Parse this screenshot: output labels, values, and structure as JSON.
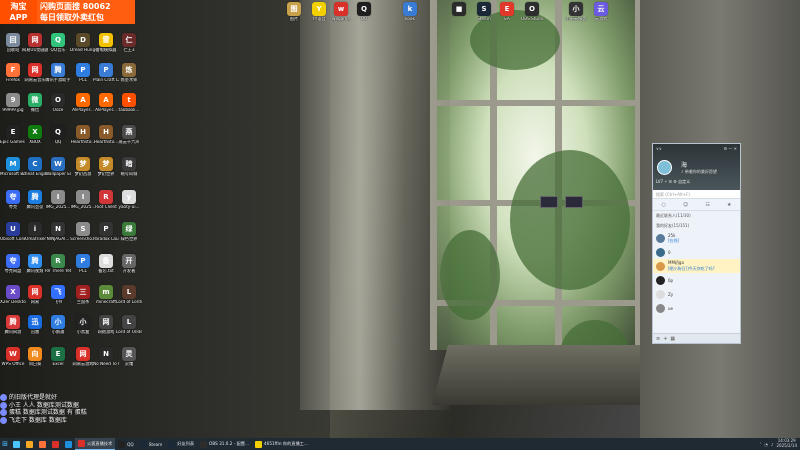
{
  "ad": {
    "left": "淘宝\nAPP",
    "line1": "闪购页面搜 80062",
    "line2": "每日领取外卖红包"
  },
  "top_icons": [
    {
      "label": "图片",
      "color": "#c9a14a",
      "icon": "folder-icon"
    },
    {
      "label": "YY语音",
      "color": "#f2d000",
      "icon": "yy-icon"
    },
    {
      "label": "wegame",
      "color": "#d9302a",
      "icon": "wegame-icon"
    },
    {
      "label": "QQ",
      "color": "#1f1f1f",
      "icon": "qq-icon"
    },
    {
      "label": "kook",
      "color": "#3a7bd5",
      "icon": "kook-icon"
    },
    {
      "label": "",
      "color": "#2b2b2b",
      "icon": "app-icon"
    },
    {
      "label": "Steam",
      "color": "#1b2838",
      "icon": "steam-icon"
    },
    {
      "label": "EA",
      "color": "#e0392b",
      "icon": "ea-icon"
    },
    {
      "label": "OBS Studio",
      "color": "#2d2d2d",
      "icon": "obs-icon"
    },
    {
      "label": "小米云服务",
      "color": "#333",
      "icon": "app-icon"
    },
    {
      "label": "云游戏",
      "color": "#6a5be0",
      "icon": "cloud-icon"
    }
  ],
  "desktop_columns": [
    [
      {
        "label": "回收站",
        "color": "#7a8a9c"
      },
      {
        "label": "Firefox",
        "color": "#ff7139"
      },
      {
        "label": "99999.jpg",
        "color": "#8c8c8c"
      },
      {
        "label": "Epic Games Launcher",
        "color": "#222"
      },
      {
        "label": "Microsoft Edge",
        "color": "#1e8fdc"
      },
      {
        "label": "夸克",
        "color": "#3b6cf6"
      },
      {
        "label": "Ubisoft Connect",
        "color": "#2a3d9c"
      },
      {
        "label": "夸克网盘",
        "color": "#3b6cf6"
      },
      {
        "label": "X2er Desktop",
        "color": "#6a4cc8"
      },
      {
        "label": "腾讯网游",
        "color": "#d83a3a"
      },
      {
        "label": "WPS Office",
        "color": "#d9302a"
      }
    ],
    [
      {
        "label": "网易UU加速器",
        "color": "#b83030"
      },
      {
        "label": "网易云音乐",
        "color": "#d9302a"
      },
      {
        "label": "微信",
        "color": "#2aae67"
      },
      {
        "label": "XBOX",
        "color": "#107c10"
      },
      {
        "label": "Cheat Engine",
        "color": "#1e6fc2"
      },
      {
        "label": "腾讯会议",
        "color": "#1b7de0"
      },
      {
        "label": "iOmatrixer",
        "color": "#2b2b2b"
      },
      {
        "label": "腾讯视频",
        "color": "#2f8df0"
      },
      {
        "label": "网易",
        "color": "#d9302a"
      },
      {
        "label": "迅雷",
        "color": "#1a6be0"
      },
      {
        "label": "向日葵",
        "color": "#f08a1c"
      }
    ],
    [
      {
        "label": "QQ音乐",
        "color": "#31c27c"
      },
      {
        "label": "腾讯手游助手",
        "color": "#3a7bd5"
      },
      {
        "label": "Ooze",
        "color": "#2a2a2a"
      },
      {
        "label": "QQ",
        "color": "#1f1f1f"
      },
      {
        "label": "Wallpaper Engine",
        "color": "#2a6fbf"
      },
      {
        "label": "IMG_2025...",
        "color": "#8c8c8c"
      },
      {
        "label": "NINJAGAI...",
        "color": "#333"
      },
      {
        "label": "RV There Yet",
        "color": "#3b8a4c"
      },
      {
        "label": "飞书",
        "color": "#3370ff"
      },
      {
        "label": "小鹅通",
        "color": "#2f7de1"
      },
      {
        "label": "Excel",
        "color": "#1d7044"
      }
    ],
    [
      {
        "label": "Dread Hunger",
        "color": "#5a4a2a"
      },
      {
        "label": "PCL",
        "color": "#2f7de1"
      },
      {
        "label": "AliPlayer...",
        "color": "#ff6a00"
      },
      {
        "label": "Hearthsto...",
        "color": "#8a5a2a"
      },
      {
        "label": "梦幻西游",
        "color": "#c48a2a"
      },
      {
        "label": "IMG_2025...",
        "color": "#8c8c8c"
      },
      {
        "label": "Screensho...",
        "color": "#8c8c8c"
      },
      {
        "label": "PCL",
        "color": "#2f7de1"
      },
      {
        "label": "三国杀",
        "color": "#a02020"
      },
      {
        "label": "小黑盒",
        "color": "#222"
      },
      {
        "label": "网易云游戏",
        "color": "#d9302a"
      }
    ],
    [
      {
        "label": "雷电模拟器",
        "color": "#f2c200"
      },
      {
        "label": "Plain Craft Launche...",
        "color": "#3a7bd5"
      },
      {
        "label": "AliPlayer...",
        "color": "#ff6a00"
      },
      {
        "label": "Hearthsto...",
        "color": "#8a5a2a"
      },
      {
        "label": "梦幻世界",
        "color": "#c48a2a"
      },
      {
        "label": "Riot Client",
        "color": "#d13639"
      },
      {
        "label": "Paradox Launcher",
        "color": "#333"
      },
      {
        "label": "备忘.txt",
        "color": "#ddd"
      },
      {
        "label": "minecraft",
        "color": "#5a8a3a"
      },
      {
        "label": "网络游戏",
        "color": "#444"
      },
      {
        "label": "No Need To Go",
        "color": "#2a2a2a"
      }
    ],
    [
      {
        "label": "仁王3",
        "color": "#6a2a2a"
      },
      {
        "label": "炼金术师",
        "color": "#8a6a3a"
      },
      {
        "label": "taobaoli...",
        "color": "#ff5000"
      },
      {
        "label": "燕云十六声",
        "color": "#4a4a4a"
      },
      {
        "label": "暗号同城",
        "color": "#3a3a3a"
      },
      {
        "label": "yaoty-ui...",
        "color": "#ddd"
      },
      {
        "label": "绿色世界",
        "color": "#3a7a3a"
      },
      {
        "label": "开发者",
        "color": "#666"
      },
      {
        "label": "Lord of Lords",
        "color": "#5a3a2a"
      },
      {
        "label": "Lord of Undead",
        "color": "#444"
      },
      {
        "label": "灵魂",
        "color": "#555"
      }
    ]
  ],
  "qq_panel": {
    "nickname": "海",
    "signature": "♪ 带着你的美好愿望",
    "vip": "LV7 ⚡ ☰ ⚙ 自定义",
    "search_placeholder": "搜索 (Ctrl+Alt+F)",
    "groups": [
      "最近联系人(11/30)",
      "我的好友(15/151)"
    ],
    "contacts": [
      {
        "name": "25k",
        "status": "[在线]",
        "color": "#5a7a9a"
      },
      {
        "name": "0",
        "status": "",
        "color": "#3a6a8a"
      },
      {
        "name": "MM初ga",
        "status": "[晒小狗日]]今天你吃了吗?",
        "color": "#d89a4a",
        "selected": true
      },
      {
        "name": "0p",
        "status": "",
        "color": "#222"
      },
      {
        "name": "Zy",
        "status": "",
        "color": "#ddd"
      },
      {
        "name": "ue",
        "status": "",
        "color": "#888"
      }
    ]
  },
  "overlay": {
    "lines": [
      "的旧版代理是就好",
      "小王 人人 数据库测试数据",
      "蛋糕 数据库测试数据 有 蛋糕",
      "飞走下 数据库 数据库"
    ]
  },
  "taskbar": {
    "buttons": [
      {
        "label": "",
        "color": "#4cc2ff",
        "icon": "search-icon"
      },
      {
        "label": "",
        "color": "#f5a623",
        "icon": "folder-icon"
      },
      {
        "label": "",
        "color": "#ff7139",
        "icon": "firefox-icon"
      },
      {
        "label": "",
        "color": "#d9302a",
        "icon": "app-icon"
      },
      {
        "label": "",
        "color": "#1e8fdc",
        "icon": "edge-icon"
      },
      {
        "label": "火狐直播技术",
        "color": "#d9302a",
        "icon": "app-icon",
        "active": true
      },
      {
        "label": "QQ",
        "color": "#222",
        "icon": "qq-icon"
      },
      {
        "label": "Steam",
        "color": "#1b2838",
        "icon": "steam-icon"
      },
      {
        "label": "好友列表",
        "color": "#1b2838",
        "icon": "steam-icon"
      },
      {
        "label": "OBS 31.0.2 - 配置...",
        "color": "#2d2d2d",
        "icon": "obs-icon"
      },
      {
        "label": "4651ffm 你的直播工...",
        "color": "#f2d000",
        "icon": "app-icon"
      }
    ],
    "time": "14:03:29",
    "date": "2025/2/14"
  }
}
